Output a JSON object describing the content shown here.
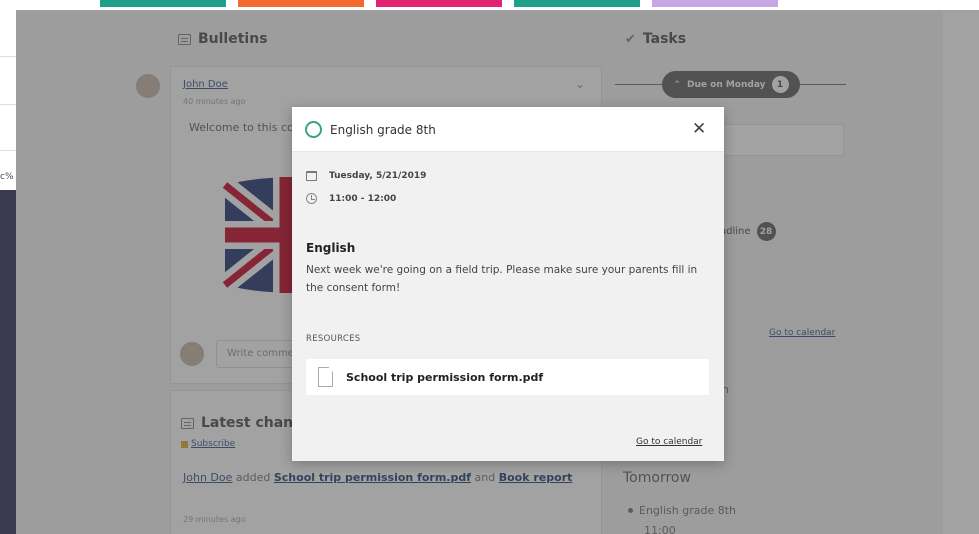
{
  "left_strip": {
    "tag": "c%"
  },
  "colors": {
    "tiles": [
      "#1f9e8a",
      "#f26a2e",
      "#e0246f",
      "#1f9e8a",
      "#c8a6e6"
    ],
    "status": "#3aa383",
    "overlay": "rgba(60,60,60,0.48)"
  },
  "bulletins": {
    "title": "Bulletins",
    "post": {
      "author": "John Doe",
      "time": "40 minutes ago",
      "text": "Welcome to this co",
      "comment_placeholder": "Write comme"
    }
  },
  "latest": {
    "title": "Latest chang",
    "subscribe": "Subscribe",
    "activity": {
      "user": "John Doe",
      "added": "added",
      "file": "School trip permission form.pdf",
      "and": "and",
      "item": "Book report"
    },
    "time": "29 minutes ago"
  },
  "tasks": {
    "title": "Tasks",
    "due_label": "Due on Monday",
    "due_count": "1",
    "deadline_label": "adline",
    "deadline_count": "28",
    "goto_calendar": "Go to calendar",
    "fragment_th": "h",
    "tomorrow": "Tomorrow",
    "tomorrow_item": "English grade 8th",
    "tomorrow_time": "11:00"
  },
  "modal": {
    "title": "English grade 8th",
    "date": "Tuesday, 5/21/2019",
    "time": "11:00 - 12:00",
    "subject": "English",
    "description": "Next week we're going on a field trip. Please make sure your parents fill in the consent form!",
    "resources_label": "RESOURCES",
    "resource_file": "School trip permission form.pdf",
    "goto_calendar": "Go to calendar"
  }
}
